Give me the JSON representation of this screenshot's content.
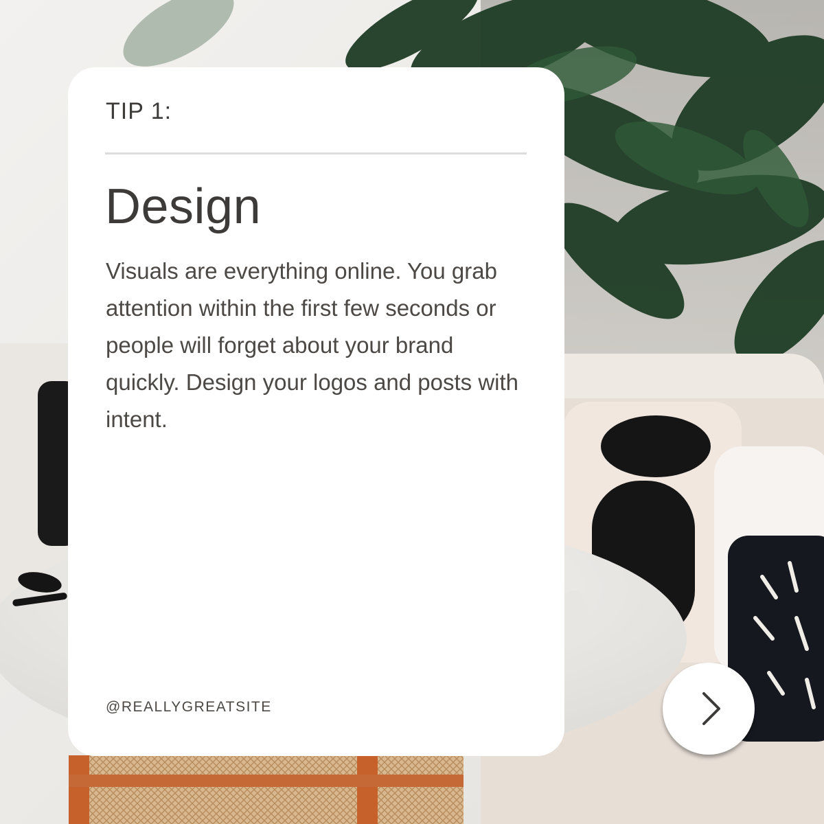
{
  "card": {
    "tip_label": "TIP 1:",
    "title": "Design",
    "body": "Visuals are everything online. You grab attention within the first few seconds or people will forget about your brand quickly. Design your logos and posts with intent.",
    "handle": "@REALLYGREATSITE"
  },
  "navigation": {
    "next_icon": "chevron-right-icon"
  },
  "colors": {
    "card_background": "#ffffff",
    "text_dark": "#3d3b39",
    "text_body": "#4b4845",
    "divider": "#dcdcdc",
    "plant_green": "#1f3d26"
  }
}
